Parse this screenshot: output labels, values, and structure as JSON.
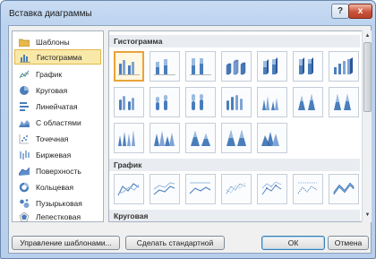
{
  "window": {
    "title": "Вставка диаграммы",
    "help_label": "?",
    "close_label": "x"
  },
  "sidebar": {
    "items": [
      {
        "label": "Шаблоны",
        "icon": "folder-icon"
      },
      {
        "label": "Гистограмма",
        "icon": "column-chart-icon",
        "selected": true
      },
      {
        "label": "График",
        "icon": "line-chart-icon"
      },
      {
        "label": "Круговая",
        "icon": "pie-chart-icon"
      },
      {
        "label": "Линейчатая",
        "icon": "bar-chart-icon"
      },
      {
        "label": "С областями",
        "icon": "area-chart-icon"
      },
      {
        "label": "Точечная",
        "icon": "scatter-chart-icon"
      },
      {
        "label": "Биржевая",
        "icon": "stock-chart-icon"
      },
      {
        "label": "Поверхность",
        "icon": "surface-chart-icon"
      },
      {
        "label": "Кольцевая",
        "icon": "doughnut-chart-icon"
      },
      {
        "label": "Пузырьковая",
        "icon": "bubble-chart-icon"
      },
      {
        "label": "Лепестковая",
        "icon": "radar-chart-icon"
      }
    ]
  },
  "gallery": {
    "sections": [
      {
        "title": "Гистограмма"
      },
      {
        "title": "График"
      },
      {
        "title": "Круговая"
      }
    ]
  },
  "buttons": {
    "manage_templates": "Управление шаблонами...",
    "set_default": "Сделать стандартной",
    "ok": "ОК",
    "cancel": "Отмена"
  },
  "colors": {
    "accent": "#4a7ebb",
    "selection": "#e9a33a"
  }
}
